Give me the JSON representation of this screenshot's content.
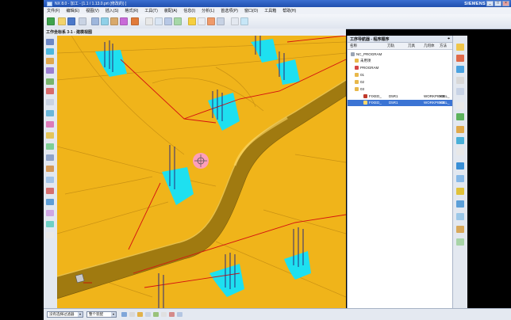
{
  "window": {
    "title": "NX 8.0 - 加工 - [1.1 / 1.13.0.prt (修改的) ]",
    "brand": "SIEMENS",
    "controls": [
      "_",
      "□",
      "×"
    ]
  },
  "menu": {
    "items": [
      "文件(F)",
      "编辑(E)",
      "视图(V)",
      "插入(S)",
      "格式(R)",
      "工具(T)",
      "装配(A)",
      "信息(I)",
      "分析(L)",
      "首选项(P)",
      "窗口(O)",
      "工具箱",
      "帮助(H)"
    ]
  },
  "tabbar": {
    "breadcrumb": "工作坐标系 3-1 - 建模视图"
  },
  "navigator": {
    "title": "工序导航器 - 程序顺序",
    "columns": [
      "名称",
      "刀轨",
      "刀具",
      "几何体",
      "方法"
    ],
    "rows": [
      {
        "label": "NC_PROGRAM",
        "indent": 0,
        "icon": "program-root-icon"
      },
      {
        "label": "未用项",
        "indent": 1,
        "icon": "folder-icon"
      },
      {
        "label": "PROGRAM",
        "indent": 1,
        "icon": "program-icon"
      },
      {
        "label": "01",
        "indent": 1,
        "icon": "folder-icon"
      },
      {
        "label": "02",
        "indent": 1,
        "icon": "folder-icon"
      },
      {
        "label": "03",
        "indent": 1,
        "icon": "folder-icon"
      },
      {
        "label": "FIXED_",
        "indent": 2,
        "icon": "operation-icon",
        "cells": [
          "D5R1",
          "",
          "WORKPIECE",
          "MILL_"
        ]
      },
      {
        "label": "FIXED_",
        "indent": 2,
        "icon": "operation-icon",
        "cells": [
          "D5R1",
          "",
          "WORKPIECE",
          "MILL_"
        ],
        "selected": true
      }
    ]
  },
  "statusbar": {
    "filter_value": "没有选择过滤器",
    "scope_value": "整个装配"
  },
  "colors": {
    "part": "#f0b41a",
    "wall": "#a07a10",
    "cyan": "#1ee0f0",
    "toolpath": "#d41010",
    "selection": "#3b74d4"
  }
}
